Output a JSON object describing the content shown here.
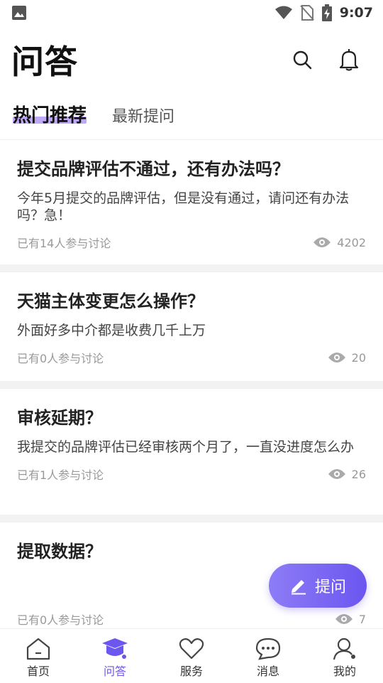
{
  "status_bar": {
    "time": "9:07"
  },
  "header": {
    "title": "问答"
  },
  "tabs": [
    {
      "label": "热门推荐",
      "active": true
    },
    {
      "label": "最新提问",
      "active": false
    }
  ],
  "questions": [
    {
      "title": "提交品牌评估不通过，还有办法吗？",
      "description": "今年5月提交的品牌评估，但是没有通过，请问还有办法吗？急！",
      "participants": "已有14人参与讨论",
      "views": "4202"
    },
    {
      "title": "天猫主体变更怎么操作？",
      "description": "外面好多中介都是收费几千上万",
      "participants": "已有0人参与讨论",
      "views": "20"
    },
    {
      "title": "审核延期？",
      "description": "我提交的品牌评估已经审核两个月了，一直没进度怎么办",
      "participants": "已有1人参与讨论",
      "views": "26"
    },
    {
      "title": "提取数据？",
      "description": "",
      "participants": "已有0人参与讨论",
      "views": "7"
    }
  ],
  "fab": {
    "label": "提问"
  },
  "bottom_nav": [
    {
      "label": "首页",
      "icon": "home-icon"
    },
    {
      "label": "问答",
      "icon": "graduation-cap-icon",
      "active": true
    },
    {
      "label": "服务",
      "icon": "heart-icon"
    },
    {
      "label": "消息",
      "icon": "chat-icon"
    },
    {
      "label": "我的",
      "icon": "user-icon"
    }
  ],
  "colors": {
    "accent": "#6c56f0",
    "tab_highlight": "#bfa8f5",
    "separator": "#f2f2f2"
  }
}
